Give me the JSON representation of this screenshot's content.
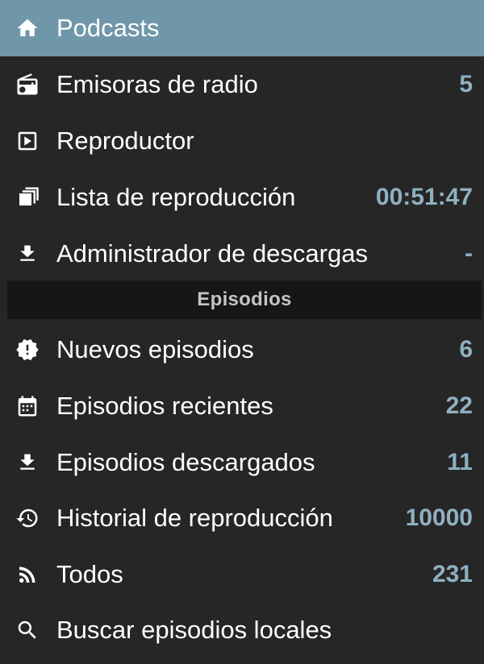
{
  "nav": {
    "podcasts": {
      "label": "Podcasts",
      "icon": "home-icon",
      "count": ""
    },
    "radio": {
      "label": "Emisoras de radio",
      "icon": "radio-icon",
      "count": "5"
    },
    "player": {
      "label": "Reproductor",
      "icon": "play-box-icon",
      "count": ""
    },
    "playlist": {
      "label": "Lista de reproducción",
      "icon": "playlist-icon",
      "count": "00:51:47"
    },
    "downloads": {
      "label": "Administrador de descargas",
      "icon": "download-icon",
      "count": "-"
    }
  },
  "section": {
    "title": "Episodios"
  },
  "episodes": {
    "new": {
      "label": "Nuevos episodios",
      "icon": "alert-badge-icon",
      "count": "6"
    },
    "recent": {
      "label": "Episodios recientes",
      "icon": "calendar-icon",
      "count": "22"
    },
    "downloaded": {
      "label": "Episodios descargados",
      "icon": "download-icon",
      "count": "11"
    },
    "history": {
      "label": "Historial de reproducción",
      "icon": "history-icon",
      "count": "10000"
    },
    "all": {
      "label": "Todos",
      "icon": "rss-icon",
      "count": "231"
    },
    "search": {
      "label": "Buscar episodios locales",
      "icon": "search-icon",
      "count": ""
    }
  },
  "colors": {
    "background": "#262626",
    "selected": "#7096aa",
    "count": "#8fb0c1",
    "section_bg": "#161616",
    "section_text": "#c4c4c4"
  }
}
